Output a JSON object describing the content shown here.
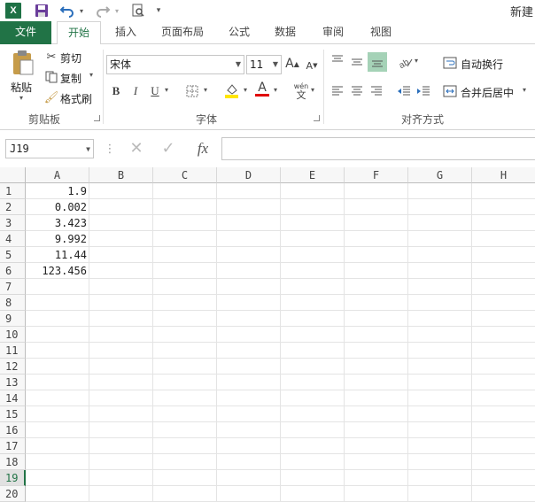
{
  "qat": {
    "logo": "X",
    "title": "新建"
  },
  "tabs": [
    {
      "label": "文件"
    },
    {
      "label": "开始"
    },
    {
      "label": "插入"
    },
    {
      "label": "页面布局"
    },
    {
      "label": "公式"
    },
    {
      "label": "数据"
    },
    {
      "label": "审阅"
    },
    {
      "label": "视图"
    }
  ],
  "clipboard": {
    "paste": "粘贴",
    "cut": "剪切",
    "copy": "复制",
    "format_painter": "格式刷",
    "group": "剪贴板"
  },
  "font": {
    "name": "宋体",
    "size": "11",
    "group": "字体",
    "bold": "B",
    "italic": "I",
    "underline": "U",
    "color_letter": "A",
    "wen": "wén",
    "wen_char": "文"
  },
  "alignment": {
    "wrap": "自动换行",
    "merge": "合并后居中",
    "group": "对齐方式"
  },
  "formula": {
    "namebox": "J19",
    "fx": "fx"
  },
  "grid": {
    "columns": [
      "A",
      "B",
      "C",
      "D",
      "E",
      "F",
      "G",
      "H"
    ],
    "rows": [
      "1",
      "2",
      "3",
      "4",
      "5",
      "6",
      "7",
      "8",
      "9",
      "10",
      "11",
      "12",
      "13",
      "14",
      "15",
      "16",
      "17",
      "18",
      "19",
      "20"
    ],
    "selected_row": "19",
    "colA_values": [
      "1.9",
      "0.002",
      "3.423",
      "9.992",
      "11.44",
      "123.456"
    ]
  },
  "colors": {
    "accent": "#217346",
    "fill_yellow": "#ffe600",
    "font_red": "#e00000"
  }
}
